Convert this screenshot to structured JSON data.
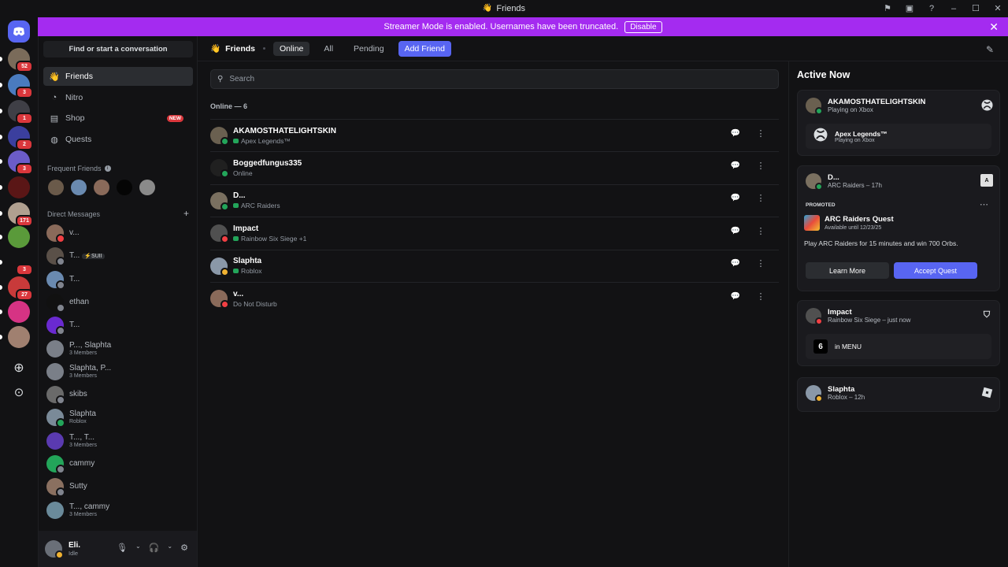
{
  "window": {
    "title": "Friends"
  },
  "banner": {
    "text": "Streamer Mode is enabled. Usernames have been truncated.",
    "disable_label": "Disable"
  },
  "rail": {
    "servers": [
      {
        "badge": "52",
        "color": "#7a6b5a"
      },
      {
        "badge": "3",
        "color": "#4a7bbf"
      },
      {
        "badge": "1",
        "color": "#3f3f46"
      },
      {
        "badge": "2",
        "color": "#3b3f9e"
      },
      {
        "badge": "3",
        "color": "#6b5cc9"
      },
      {
        "badge": "",
        "color": "#5a1616"
      },
      {
        "badge": "171",
        "color": "#b0a090"
      },
      {
        "badge": "",
        "color": "#5a9a3a"
      },
      {
        "badge": "3",
        "color": "#121214"
      },
      {
        "badge": "27",
        "color": "#c83a3a"
      },
      {
        "badge": "",
        "color": "#d63384"
      },
      {
        "badge": "",
        "color": "#a08070"
      }
    ]
  },
  "sidebar": {
    "search_label": "Find or start a conversation",
    "nav": [
      {
        "label": "Friends",
        "icon": "friends-icon"
      },
      {
        "label": "Nitro",
        "icon": "nitro-icon"
      },
      {
        "label": "Shop",
        "icon": "shop-icon",
        "badge": "NEW"
      },
      {
        "label": "Quests",
        "icon": "quests-icon"
      }
    ],
    "frequent_label": "Frequent Friends",
    "dm_label": "Direct Messages",
    "dms": [
      {
        "name": "v...",
        "sub": "",
        "color": "#8a6a5a",
        "status": "#f23f43"
      },
      {
        "name": "T...",
        "tag": "⚡SUII",
        "sub": "",
        "color": "#5a5048",
        "status": "#80848e"
      },
      {
        "name": "T...",
        "sub": "",
        "color": "#6a8ab0",
        "status": "#80848e"
      },
      {
        "name": "ethan",
        "sub": "",
        "color": "#111111",
        "status": "#80848e"
      },
      {
        "name": "T...",
        "sub": "",
        "color": "#6a2ad0",
        "status": "#80848e"
      },
      {
        "name": "P..., Slaphta",
        "sub": "3 Members",
        "color": "#7a7f88",
        "status": ""
      },
      {
        "name": "Slaphta, P...",
        "sub": "3 Members",
        "color": "#7a7f88",
        "status": ""
      },
      {
        "name": "skibs",
        "sub": "",
        "color": "#6a6a6a",
        "status": "#80848e"
      },
      {
        "name": "Slaphta",
        "sub": "Roblox",
        "color": "#7a8a98",
        "status": "#23a55a"
      },
      {
        "name": "T..., T...",
        "sub": "3 Members",
        "color": "#5a3ab0",
        "status": ""
      },
      {
        "name": "cammy",
        "sub": "",
        "color": "#23a55a",
        "status": "#80848e"
      },
      {
        "name": "Sutty",
        "sub": "",
        "color": "#8a7060",
        "status": "#80848e"
      },
      {
        "name": "T..., cammy",
        "sub": "3 Members",
        "color": "#6a8a9a",
        "status": ""
      }
    ],
    "user": {
      "name": "Eli.",
      "status": "Idle"
    }
  },
  "topbar": {
    "title": "Friends",
    "tabs": [
      "Online",
      "All",
      "Pending"
    ],
    "add_friend": "Add Friend"
  },
  "main": {
    "search_placeholder": "Search",
    "online_header": "Online — 6",
    "friends": [
      {
        "name": "AKAMOSTHATELIGHTSKIN",
        "activity": "Apex Legends™",
        "game": true,
        "color": "#6a6050",
        "status": "#23a55a"
      },
      {
        "name": "Boggedfungus335",
        "activity": "Online",
        "game": false,
        "color": "#202020",
        "status": "#23a55a"
      },
      {
        "name": "D...",
        "activity": "ARC Raiders",
        "game": true,
        "color": "#7a7060",
        "status": "#23a55a"
      },
      {
        "name": "Impact",
        "activity": "Rainbow Six Siege +1",
        "game": true,
        "color": "#505050",
        "status": "#f23f43"
      },
      {
        "name": "Slaphta",
        "activity": "Roblox",
        "game": true,
        "color": "#8a98a8",
        "status": "#f0b232"
      },
      {
        "name": "v...",
        "activity": "Do Not Disturb",
        "game": false,
        "color": "#8a6a5a",
        "status": "#f23f43"
      }
    ]
  },
  "active_now": {
    "title": "Active Now",
    "cards": [
      {
        "name": "AKAMOSTHATELIGHTSKIN",
        "sub": "Playing on Xbox",
        "inner_title": "Apex Legends™",
        "inner_sub": "Playing on Xbox"
      },
      {
        "name": "D...",
        "sub": "ARC Raiders – 17h",
        "promoted": "PROMOTED",
        "quest_title": "ARC Raiders Quest",
        "quest_avail": "Available until 12/23/25",
        "quest_desc": "Play ARC Raiders for 15 minutes and win 700 Orbs.",
        "learn_more": "Learn More",
        "accept": "Accept Quest"
      },
      {
        "name": "Impact",
        "sub": "Rainbow Six Siege – just now",
        "inner_title": "in MENU"
      },
      {
        "name": "Slaphta",
        "sub": "Roblox – 12h"
      }
    ]
  }
}
